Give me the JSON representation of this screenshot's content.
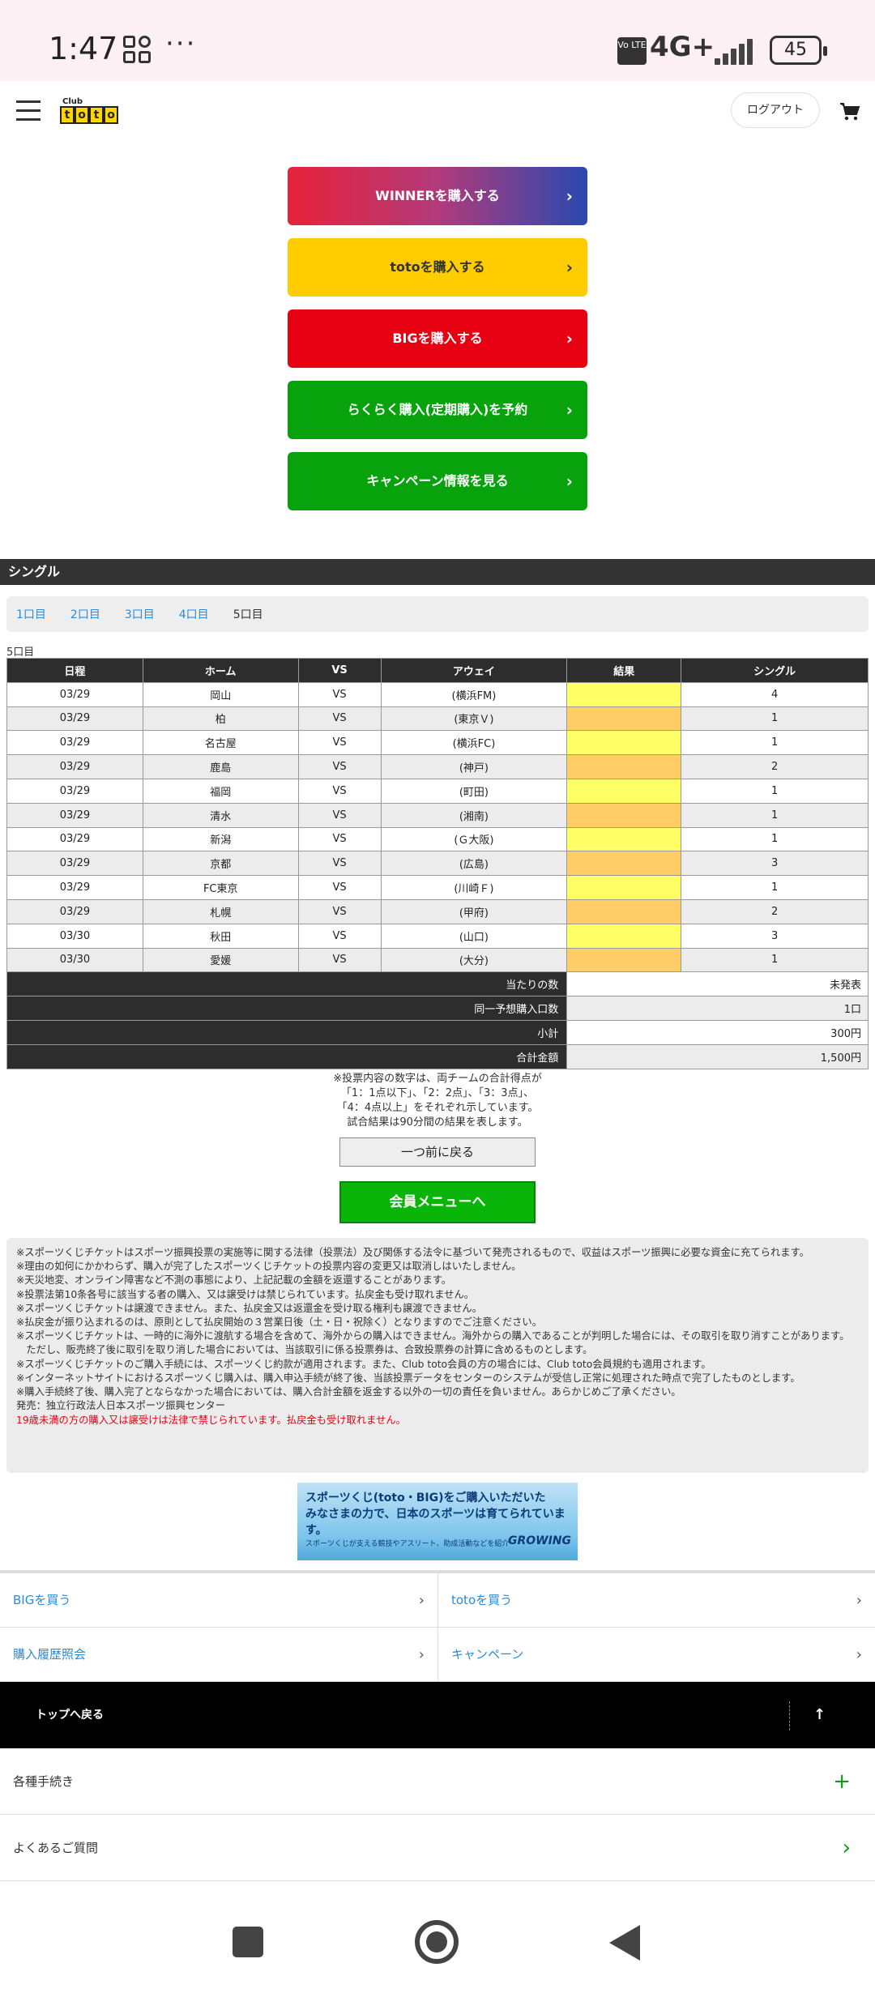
{
  "status_bar": {
    "time": "1:47",
    "network": "4G+",
    "volte": "Vo LTE",
    "battery": "45"
  },
  "header": {
    "logo_top": "Club",
    "logo_letters": [
      "t",
      "o",
      "t",
      "o"
    ],
    "logout_label": "ログアウト",
    "cart_icon": "cart-icon"
  },
  "buttons": {
    "winner": "WINNERを購入する",
    "toto": "totoを購入する",
    "big": "BIGを購入する",
    "raku": "らくらく購入(定期購入)を予約",
    "campaign": "キャンペーン情報を見る",
    "arrow": "›"
  },
  "section": {
    "title": "シングル",
    "tabs": [
      "1口目",
      "2口目",
      "3口目",
      "4口目",
      "5口目"
    ],
    "active_tab": "5口目",
    "round_label": "5口目"
  },
  "table": {
    "headers": [
      "日程",
      "ホーム",
      "VS",
      "アウェイ",
      "結果",
      "シングル"
    ],
    "rows": [
      {
        "date": "03/29",
        "home": "岡山",
        "vs": "VS",
        "away": "(横浜FM)",
        "result": "",
        "single": "4"
      },
      {
        "date": "03/29",
        "home": "柏",
        "vs": "VS",
        "away": "(東京Ｖ)",
        "result": "",
        "single": "1"
      },
      {
        "date": "03/29",
        "home": "名古屋",
        "vs": "VS",
        "away": "(横浜FC)",
        "result": "",
        "single": "1"
      },
      {
        "date": "03/29",
        "home": "鹿島",
        "vs": "VS",
        "away": "(神戸)",
        "result": "",
        "single": "2"
      },
      {
        "date": "03/29",
        "home": "福岡",
        "vs": "VS",
        "away": "(町田)",
        "result": "",
        "single": "1"
      },
      {
        "date": "03/29",
        "home": "清水",
        "vs": "VS",
        "away": "(湘南)",
        "result": "",
        "single": "1"
      },
      {
        "date": "03/29",
        "home": "新潟",
        "vs": "VS",
        "away": "(Ｇ大阪)",
        "result": "",
        "single": "1"
      },
      {
        "date": "03/29",
        "home": "京都",
        "vs": "VS",
        "away": "(広島)",
        "result": "",
        "single": "3"
      },
      {
        "date": "03/29",
        "home": "FC東京",
        "vs": "VS",
        "away": "(川崎Ｆ)",
        "result": "",
        "single": "1"
      },
      {
        "date": "03/29",
        "home": "札幌",
        "vs": "VS",
        "away": "(甲府)",
        "result": "",
        "single": "2"
      },
      {
        "date": "03/30",
        "home": "秋田",
        "vs": "VS",
        "away": "(山口)",
        "result": "",
        "single": "3"
      },
      {
        "date": "03/30",
        "home": "愛媛",
        "vs": "VS",
        "away": "(大分)",
        "result": "",
        "single": "1"
      }
    ],
    "summary": [
      {
        "label": "当たりの数",
        "value": "未発表"
      },
      {
        "label": "同一予想購入口数",
        "value": "1口"
      },
      {
        "label": "小計",
        "value": "300円"
      },
      {
        "label": "合計金額",
        "value": "1,500円"
      }
    ]
  },
  "note": {
    "line1": "※投票内容の数字は、両チームの合計得点が",
    "line2": "「1：1点以下」、「2：2点」、「3：3点」、",
    "line3": "「4：4点以上」をそれぞれ示しています。",
    "line4": "試合結果は90分間の結果を表します。"
  },
  "actions": {
    "back": "一つ前に戻る",
    "member_menu": "会員メニューへ"
  },
  "disclaimer": {
    "lines": [
      "※スポーツくじチケットはスポーツ振興投票の実施等に関する法律（投票法）及び関係する法令に基づいて発売されるもので、収益はスポーツ振興に必要な資金に充てられます。",
      "※理由の如何にかかわらず、購入が完了したスポーツくじチケットの投票内容の変更又は取消しはいたしません。",
      "※天災地変、オンライン障害など不測の事態により、上記記載の金額を返還することがあります。",
      "※投票法第10条各号に該当する者の購入、又は譲受けは禁じられています。払戻金も受け取れません。",
      "※スポーツくじチケットは譲渡できません。また、払戻金又は返還金を受け取る権利も譲渡できません。",
      "※払戻金が振り込まれるのは、原則として払戻開始の３営業日後（土・日・祝除く）となりますのでご注意ください。",
      "※スポーツくじチケットは、一時的に海外に渡航する場合を含めて、海外からの購入はできません。海外からの購入であることが判明した場合には、その取引を取り消すことがあります。ただし、販売終了後に取引を取り消した場合においては、当該取引に係る投票券は、合致投票券の計算に含めるものとします。",
      "※スポーツくじチケットのご購入手続には、スポーツくじ約款が適用されます。また、Club toto会員の方の場合には、Club toto会員規約も適用されます。",
      "※インターネットサイトにおけるスポーツくじ購入は、購入申込手続が終了後、当該投票データをセンターのシステムが受信し正常に処理された時点で完了したものとします。",
      "※購入手続終了後、購入完了とならなかった場合においては、購入合計金額を返金する以外の一切の責任を負いません。あらかじめご了承ください。",
      "発売：独立行政法人日本スポーツ振興センター"
    ],
    "warning": "19歳未満の方の購入又は譲受けは法律で禁じられています。払戻金も受け取れません。"
  },
  "banner": {
    "line1": "スポーツくじ(toto・BIG)をご購入いただいた",
    "line2": "みなさまの力で、日本のスポーツは育てられています。",
    "line3": "スポーツくじが支える競技やアスリート、助成活動などを紹介",
    "brand": "GROWING"
  },
  "links": {
    "buy_big": "BIGを買う",
    "buy_toto": "totoを買う",
    "history": "購入履歴照会",
    "campaign": "キャンペーン",
    "chevron": "›"
  },
  "footer": {
    "to_top": "トップへ戻る",
    "up_arrow": "↑",
    "procedures": "各種手続き",
    "faq": "よくあるご質問",
    "plus": "+",
    "chev": "›"
  }
}
